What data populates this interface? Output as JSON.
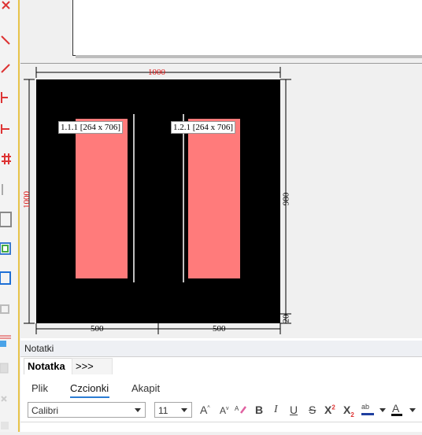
{
  "drawing": {
    "top_width_label": "1000",
    "left_height_label": "1000",
    "right_height_label": "980",
    "right_small_label": "20",
    "bottom_left_label": "500",
    "bottom_right_label": "500",
    "element_left_label": "1.1.1 [264 x 706]",
    "element_right_label": "1.2.1 [264 x 706]"
  },
  "notes_panel": {
    "title": "Notatki",
    "tab_active": "Notatka",
    "tab_more": ">>>",
    "ribbon_tabs": [
      "Plik",
      "Czcionki",
      "Akapit"
    ],
    "font_family": "Calibri",
    "font_size": "11",
    "format_buttons": {
      "grow": "A",
      "shrink": "A",
      "bold": "B",
      "italic": "I",
      "underline": "U",
      "strike": "S",
      "superscript": "X",
      "subscript": "X",
      "highlight": "ab",
      "font_color": "A"
    }
  },
  "colors": {
    "accent_red": "#d11111",
    "panel_fill": "#ff7b7b",
    "board": "#000000"
  }
}
